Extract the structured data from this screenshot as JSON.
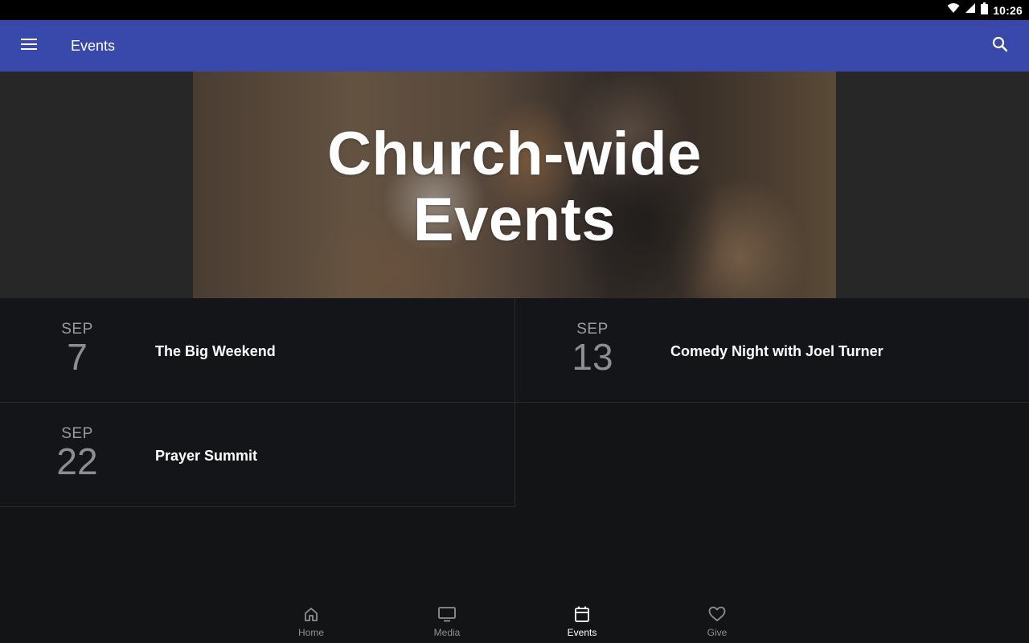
{
  "status_bar": {
    "time": "10:26"
  },
  "app_bar": {
    "title": "Events"
  },
  "hero": {
    "title_line1": "Church-wide",
    "title_line2": "Events"
  },
  "events": [
    {
      "month": "SEP",
      "day": "7",
      "title": "The Big Weekend"
    },
    {
      "month": "SEP",
      "day": "13",
      "title": "Comedy Night with Joel Turner"
    },
    {
      "month": "SEP",
      "day": "22",
      "title": "Prayer Summit"
    }
  ],
  "bottom_nav": {
    "items": [
      {
        "label": "Home",
        "icon": "home-icon",
        "active": false
      },
      {
        "label": "Media",
        "icon": "tv-icon",
        "active": false
      },
      {
        "label": "Events",
        "icon": "calendar-icon",
        "active": true
      },
      {
        "label": "Give",
        "icon": "heart-icon",
        "active": false
      }
    ]
  },
  "colors": {
    "app_bar": "#3949ab",
    "background": "#131416",
    "hero_band": "#272727"
  }
}
